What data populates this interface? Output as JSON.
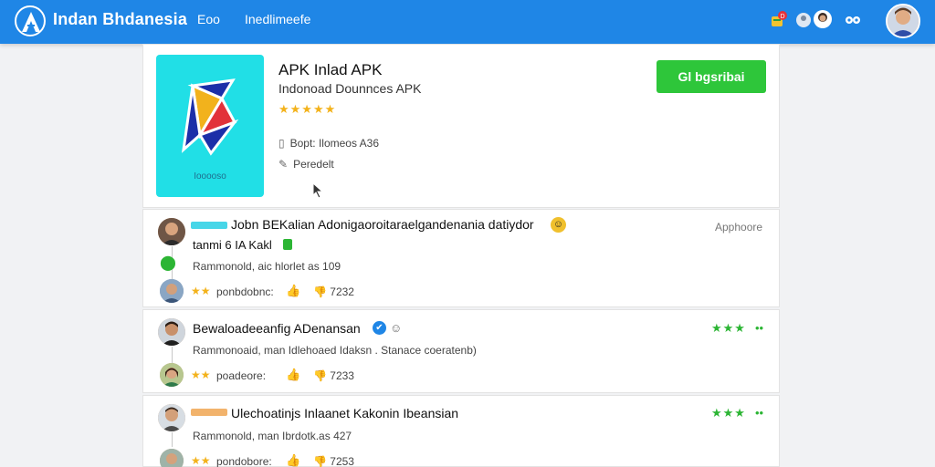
{
  "header": {
    "brand": "Indan Bhdanesia",
    "nav": [
      "Eoo",
      "Inedlimeefe"
    ],
    "notification_badge": "D"
  },
  "app": {
    "title": "APK Inlad APK",
    "subtitle": "Indonoad Dounnces APK",
    "stars": "★★★★★",
    "icon_label": "Iooooso",
    "info": [
      "Bopt: Ilomeos A36",
      "Peredelt"
    ],
    "download_label": "Gl bgsribai"
  },
  "reviews": [
    {
      "name": "Jobn BEKalian Adonigaoroitaraelgandenania datiydor",
      "tag": "tanmi 6 IA Kakl",
      "meta": "Rammonold, aic hlorlet as 109",
      "stars": "★★",
      "helpful": "ponbdobnc:",
      "dislike_count": "7232",
      "app_label": "Apphoore",
      "bar_color": "#47d6e8"
    },
    {
      "name": "Bewaloadeeanfig ADenansan",
      "meta": "Rammonoaid, man Idlehoaed Idaksn . Stanace coeratenb)",
      "stars": "★★",
      "helpful": "poadeore:",
      "dislike_count": "7233",
      "rating_green": "★★★",
      "dots": "••"
    },
    {
      "name": "Ulechoatinjs Inlaanet Kakonin Ibeansian",
      "meta": "Rammonold, man Ibrdotk.as 427",
      "stars": "★★",
      "helpful": "pondobore:",
      "dislike_count": "7253",
      "rating_green": "★★★",
      "dots": "••",
      "bar_color": "#f2b36c"
    }
  ],
  "colors": {
    "topbar": "#1f86e6",
    "download": "#2ec63a",
    "app_icon_bg": "#21dfe6",
    "star": "#f3b21b",
    "green_rating": "#2cb534"
  }
}
